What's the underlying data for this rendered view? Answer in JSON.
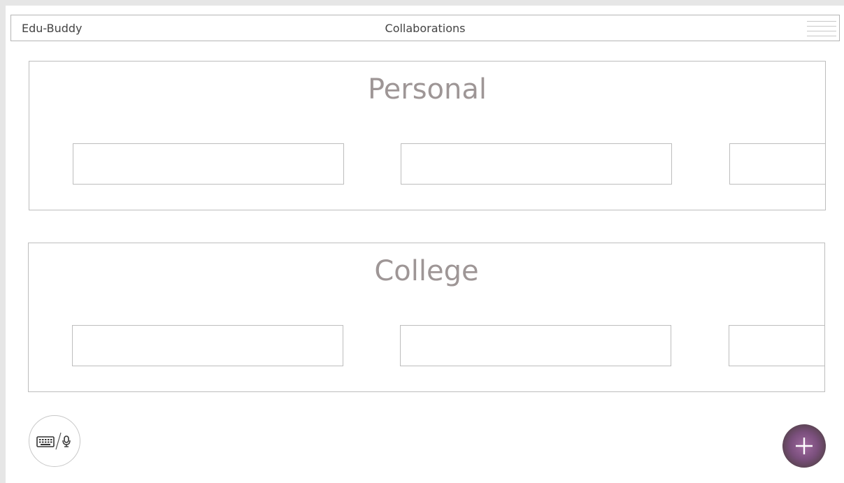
{
  "header": {
    "app_title": "Edu-Buddy",
    "page_title": "Collaborations",
    "menu_icon": "hamburger-menu-icon"
  },
  "sections": [
    {
      "title": "Personal",
      "cards": [
        "",
        "",
        ""
      ]
    },
    {
      "title": "College",
      "cards": [
        "",
        "",
        ""
      ]
    }
  ],
  "controls": {
    "input_mode_icons": [
      "keyboard-icon",
      "microphone-icon"
    ],
    "add_icon": "plus-icon"
  },
  "colors": {
    "section_title": "#9e9696",
    "border": "#bdbdbd",
    "fab_center": "#a06aa0",
    "fab_edge": "#3d3a2b"
  }
}
